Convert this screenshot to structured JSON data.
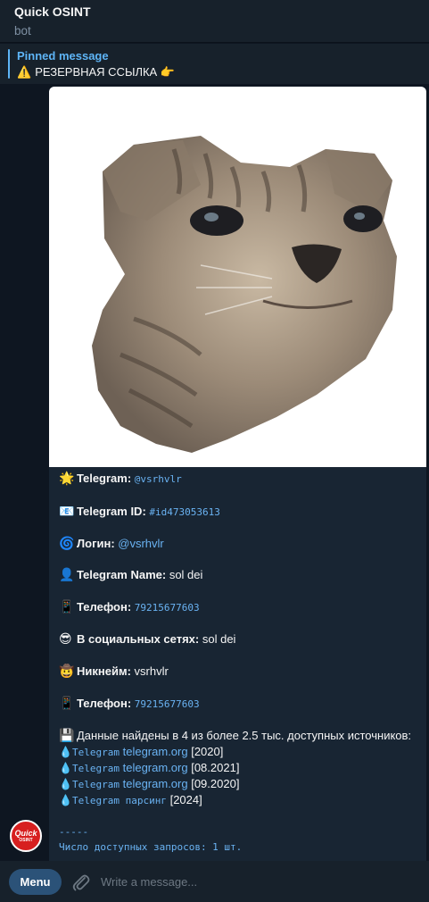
{
  "header": {
    "title": "Quick OSINT",
    "subtitle": "bot"
  },
  "pinned": {
    "title": "Pinned message",
    "text": "РЕЗЕРВНАЯ ССЫЛКА 👉",
    "warn_glyph": "⚠️"
  },
  "message": {
    "lines": [
      {
        "emoji": "🌟",
        "label": "Telegram:",
        "value": "@vsrhvlr",
        "value_style": "mono"
      },
      {
        "emoji": "📧",
        "label": "Telegram ID:",
        "value": "#id473053613",
        "value_style": "mono"
      },
      {
        "emoji": "🌀",
        "label": "Логин:",
        "value": "@vsrhvlr",
        "value_style": "link"
      },
      {
        "emoji": "👤",
        "label": "Telegram Name:",
        "value": "sol dei",
        "value_style": "plain"
      },
      {
        "emoji": "📱",
        "label": "Телефон:",
        "value": "79215677603",
        "value_style": "mono"
      },
      {
        "emoji": "😎",
        "label": "В социальных сетях:",
        "value": "sol dei",
        "value_style": "plain"
      },
      {
        "emoji": "🤠",
        "label": "Никнейм:",
        "value": "vsrhvlr",
        "value_style": "plain"
      },
      {
        "emoji": "📱",
        "label": "Телефон:",
        "value": "79215677603",
        "value_style": "mono"
      }
    ],
    "found_text": "Данные найдены в 4 из более 2.5 тыс. доступных источников:",
    "found_emoji": "💾",
    "sources": [
      {
        "tag": "Telegram",
        "link": "telegram.org",
        "date": "[2020]"
      },
      {
        "tag": "Telegram",
        "link": "telegram.org",
        "date": "[08.2021]"
      },
      {
        "tag": "Telegram",
        "link": "telegram.org",
        "date": "[09.2020]"
      },
      {
        "tag": "Telegram парсинг",
        "link": "",
        "date": "[2024]"
      }
    ],
    "divider": "-----",
    "requests": "Число доступных запросов: 1 шт."
  },
  "avatar": {
    "line1": "Quick",
    "line2": "OSINT"
  },
  "composer": {
    "menu_label": "Menu",
    "placeholder": "Write a message..."
  },
  "colors": {
    "accent": "#5eb5f7",
    "link": "#6ab3f3",
    "bubble": "#182533",
    "bg": "#0e1621",
    "panel": "#17212b",
    "menu_btn": "#2b5278"
  }
}
